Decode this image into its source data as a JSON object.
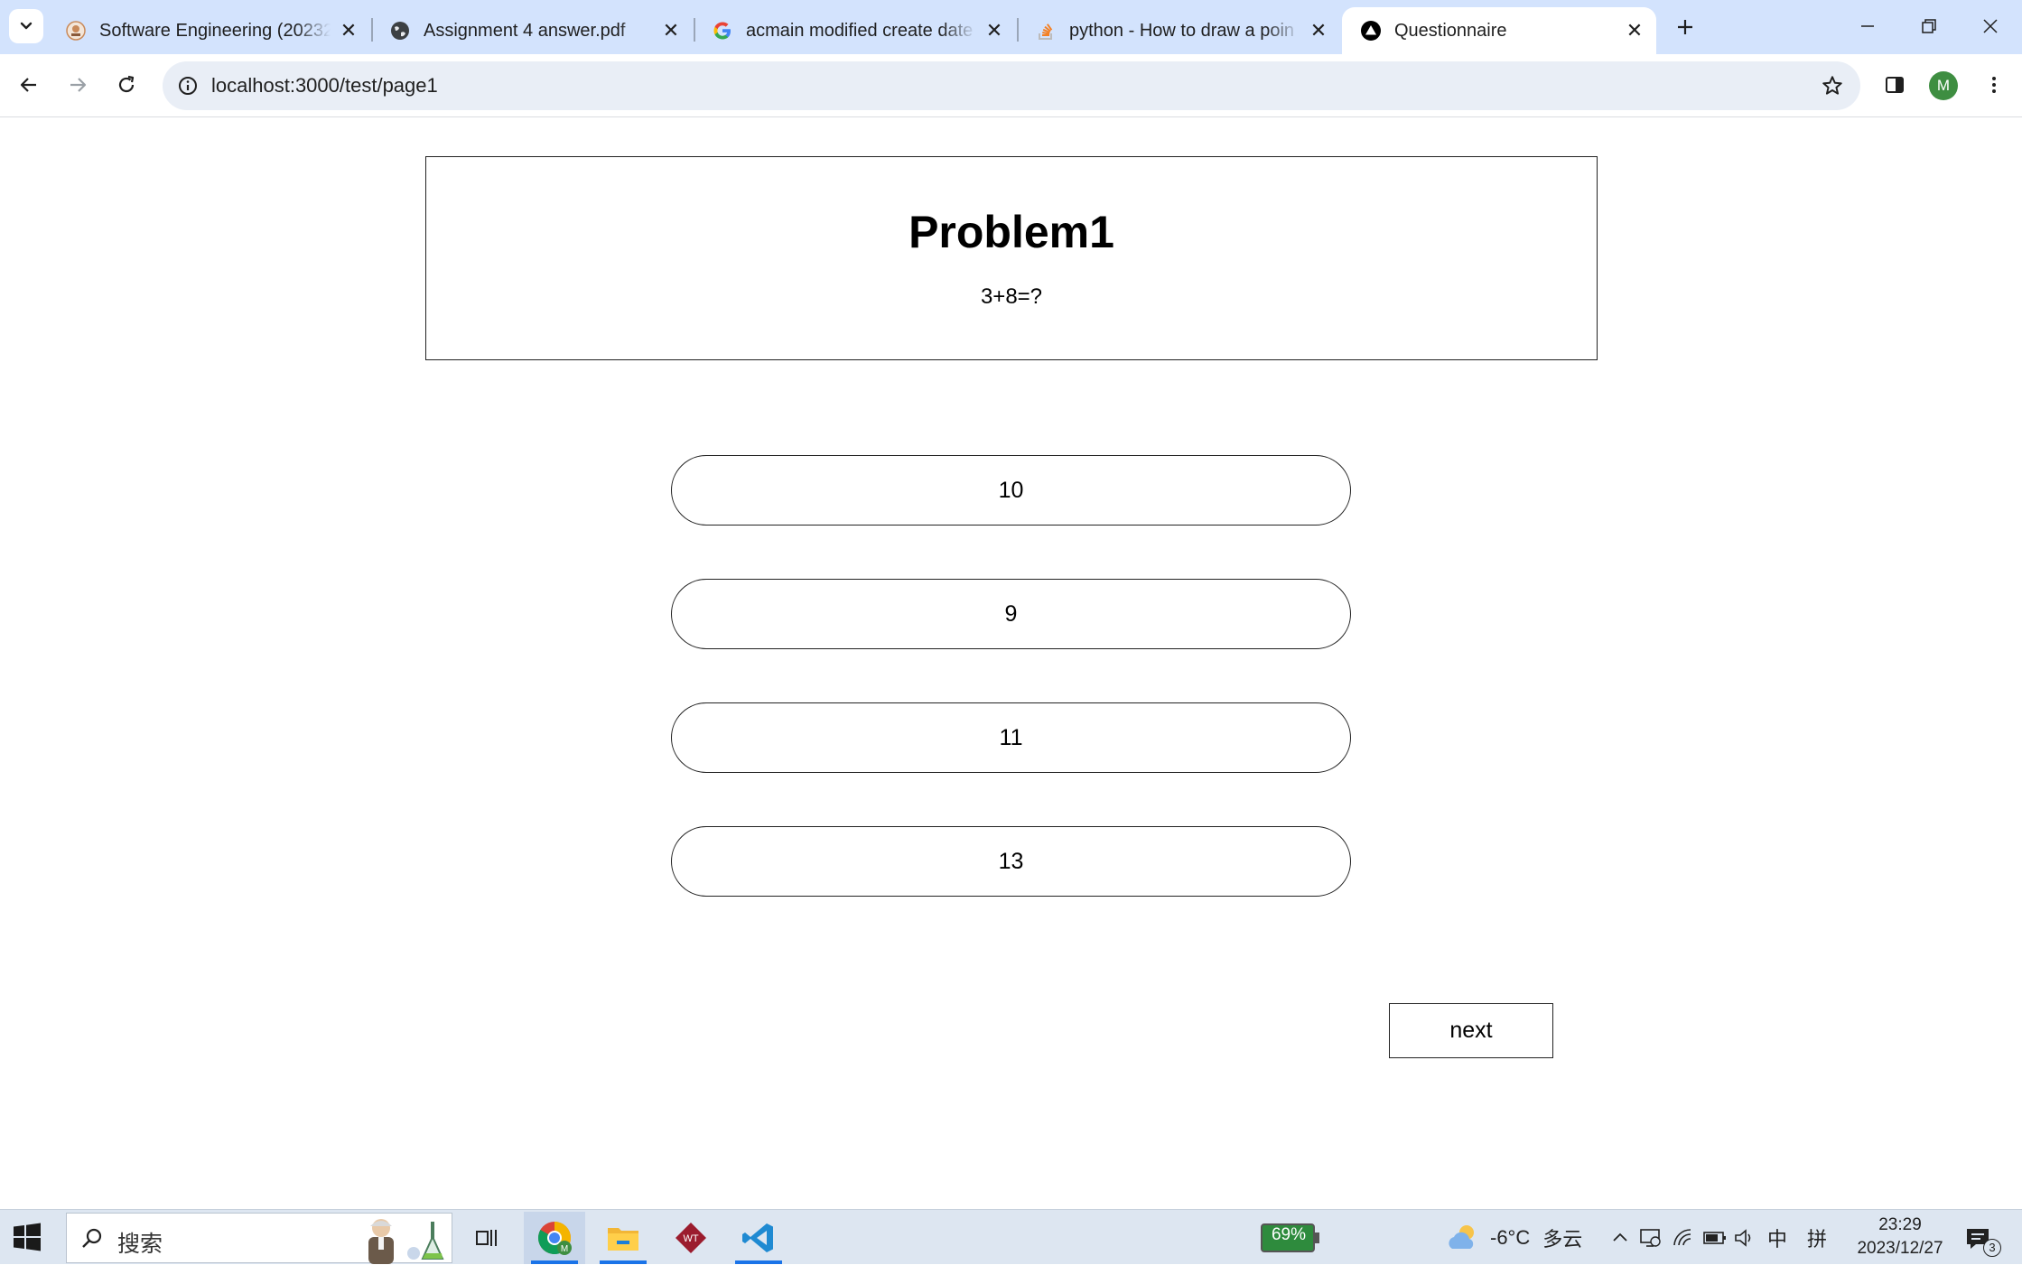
{
  "browser": {
    "tabs": [
      {
        "title": "Software Engineering (20232",
        "favicon": "course-favicon",
        "active": false
      },
      {
        "title": "Assignment 4 answer.pdf",
        "favicon": "globe-favicon",
        "active": false
      },
      {
        "title": "acmain modified create date",
        "favicon": "google-favicon",
        "active": false
      },
      {
        "title": "python - How to draw a poin",
        "favicon": "stackoverflow-favicon",
        "active": false
      },
      {
        "title": "Questionnaire",
        "favicon": "triangle-favicon",
        "active": true
      }
    ],
    "address": "localhost:3000/test/page1",
    "profile_initial": "M"
  },
  "page": {
    "problem_title": "Problem1",
    "question": "3+8=?",
    "options": [
      "10",
      "9",
      "11",
      "13"
    ],
    "next_label": "next"
  },
  "taskbar": {
    "search_placeholder": "搜索",
    "battery_percent": "69%",
    "weather_temp": "-6°C",
    "weather_desc": "多云",
    "ime_lang": "中",
    "ime_mode": "拼",
    "time": "23:29",
    "date": "2023/12/27",
    "notification_count": "3"
  },
  "colors": {
    "tabstrip_bg": "#d3e3fd",
    "omnibox_bg": "#e9eef6",
    "taskbar_bg": "#dde6f1",
    "avatar_bg": "#3e8e41",
    "accent": "#1a73e8"
  }
}
